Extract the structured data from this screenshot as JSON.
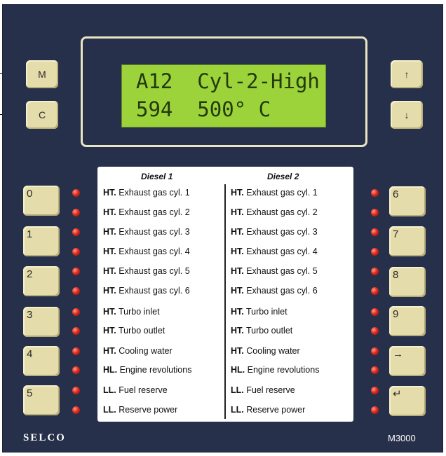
{
  "display": {
    "line1": "A12  Cyl-2-High",
    "line2": "594  500° C"
  },
  "side_keys": {
    "m": "M",
    "c": "C",
    "up": "↑",
    "down": "↓"
  },
  "left_keys": [
    "0",
    "1",
    "2",
    "3",
    "4",
    "5"
  ],
  "right_keys": [
    "6",
    "7",
    "8",
    "9",
    "→",
    "↵"
  ],
  "card": {
    "col1_title": "Diesel 1",
    "col2_title": "Diesel 2",
    "rows": [
      {
        "prefix": "HT.",
        "text": " Exhaust gas cyl. 1"
      },
      {
        "prefix": "HT.",
        "text": " Exhaust gas cyl. 2"
      },
      {
        "prefix": "HT.",
        "text": " Exhaust gas cyl. 3"
      },
      {
        "prefix": "HT.",
        "text": " Exhaust gas cyl. 4"
      },
      {
        "prefix": "HT.",
        "text": " Exhaust gas cyl. 5"
      },
      {
        "prefix": "HT.",
        "text": " Exhaust gas cyl. 6"
      },
      {
        "prefix": "HT.",
        "text": " Turbo inlet"
      },
      {
        "prefix": "HT.",
        "text": " Turbo outlet"
      },
      {
        "prefix": "HT.",
        "text": " Cooling water"
      },
      {
        "prefix": "HL.",
        "text": " Engine revolutions"
      },
      {
        "prefix": "LL.",
        "text": " Fuel reserve"
      },
      {
        "prefix": "LL.",
        "text": " Reserve power"
      }
    ]
  },
  "brand": "SELCO",
  "model": "M3000",
  "colors": {
    "panel": "#26304a",
    "key": "#e5dcab",
    "lcd": "#9cd23a",
    "led": "#e12a1e"
  }
}
